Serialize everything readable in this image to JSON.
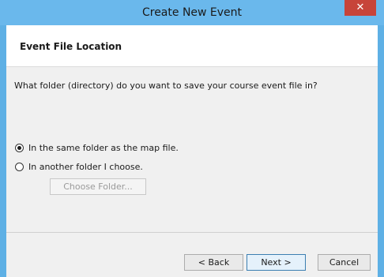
{
  "window": {
    "title": "Create New Event",
    "close_glyph": "✕"
  },
  "header": {
    "title": "Event File Location"
  },
  "content": {
    "question": "What folder (directory) do you want to save your course event file in?",
    "options": [
      {
        "label": "In the same folder as the map file.",
        "checked": true
      },
      {
        "label": "In another folder I choose.",
        "checked": false
      }
    ],
    "choose_folder_label": "Choose Folder..."
  },
  "footer": {
    "back_label": "< Back",
    "next_label": "Next >",
    "cancel_label": "Cancel"
  },
  "colors": {
    "titlebar": "#6ab8ec",
    "close_button": "#c7443a",
    "dialog_background": "#f0f0f0"
  }
}
